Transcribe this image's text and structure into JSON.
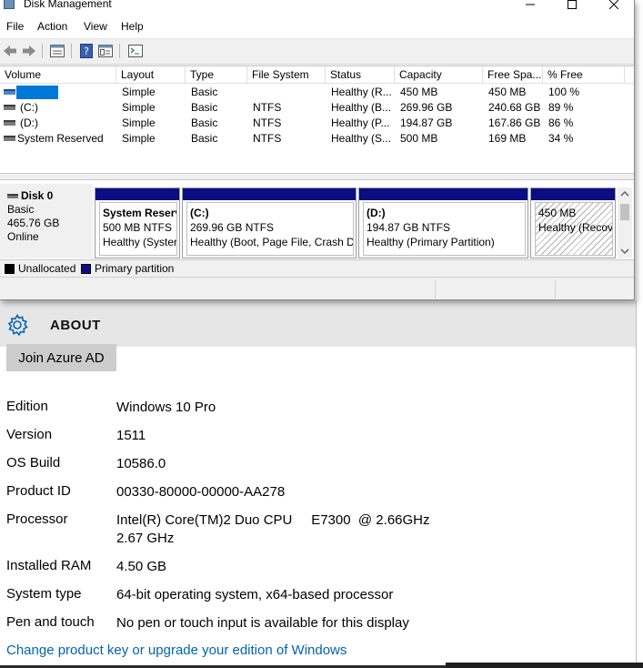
{
  "window": {
    "title": "Disk Management",
    "menu": [
      "File",
      "Action",
      "View",
      "Help"
    ]
  },
  "toolbar_icons": [
    "back-arrow-icon",
    "forward-arrow-icon",
    "list-view-icon",
    "help-icon",
    "properties-icon",
    "console-icon"
  ],
  "volume_table": {
    "columns": [
      "Volume",
      "Layout",
      "Type",
      "File System",
      "Status",
      "Capacity",
      "Free Spa...",
      "% Free"
    ],
    "rows": [
      {
        "volume": "",
        "layout": "Simple",
        "type": "Basic",
        "fs": "",
        "status": "Healthy (R...",
        "capacity": "450 MB",
        "free": "450 MB",
        "pct": "100 %"
      },
      {
        "volume": "(C:)",
        "layout": "Simple",
        "type": "Basic",
        "fs": "NTFS",
        "status": "Healthy (B...",
        "capacity": "269.96 GB",
        "free": "240.68 GB",
        "pct": "89 %"
      },
      {
        "volume": "(D:)",
        "layout": "Simple",
        "type": "Basic",
        "fs": "NTFS",
        "status": "Healthy (P...",
        "capacity": "194.87 GB",
        "free": "167.86 GB",
        "pct": "86 %"
      },
      {
        "volume": "System Reserved",
        "layout": "Simple",
        "type": "Basic",
        "fs": "NTFS",
        "status": "Healthy (S...",
        "capacity": "500 MB",
        "free": "169 MB",
        "pct": "34 %"
      }
    ]
  },
  "disk": {
    "name": "Disk 0",
    "type": "Basic",
    "size": "465.76 GB",
    "state": "Online",
    "partitions": [
      {
        "name": "System Reserv",
        "size": "500 MB NTFS",
        "status": "Healthy (Syster"
      },
      {
        "name": "(C:)",
        "size": "269.96 GB NTFS",
        "status": "Healthy (Boot, Page File, Crash Du"
      },
      {
        "name": "(D:)",
        "size": "194.87 GB NTFS",
        "status": "Healthy (Primary Partition)"
      },
      {
        "name": "",
        "size": "450 MB",
        "status": "Healthy (Recov"
      }
    ]
  },
  "legend": {
    "unallocated": "Unallocated",
    "primary": "Primary partition",
    "unallocated_color": "#000000",
    "primary_color": "#0a0e82"
  },
  "about": {
    "header": "ABOUT",
    "join_button": "Join Azure AD",
    "rows": [
      {
        "label": "Edition",
        "value": "Windows 10 Pro"
      },
      {
        "label": "Version",
        "value": "1511"
      },
      {
        "label": "OS Build",
        "value": "10586.0"
      },
      {
        "label": "Product ID",
        "value": "00330-80000-00000-AA278"
      },
      {
        "label": "Processor",
        "value": "Intel(R) Core(TM)2 Duo CPU     E7300  @ 2.66GHz",
        "value2": "2.67 GHz"
      },
      {
        "label": "Installed RAM",
        "value": "4.50 GB"
      },
      {
        "label": "System type",
        "value": "64-bit operating system, x64-based processor"
      },
      {
        "label": "Pen and touch",
        "value": "No pen or touch input is available for this display"
      }
    ],
    "link": "Change product key or upgrade your edition of Windows",
    "link_color": "#0063b1"
  }
}
